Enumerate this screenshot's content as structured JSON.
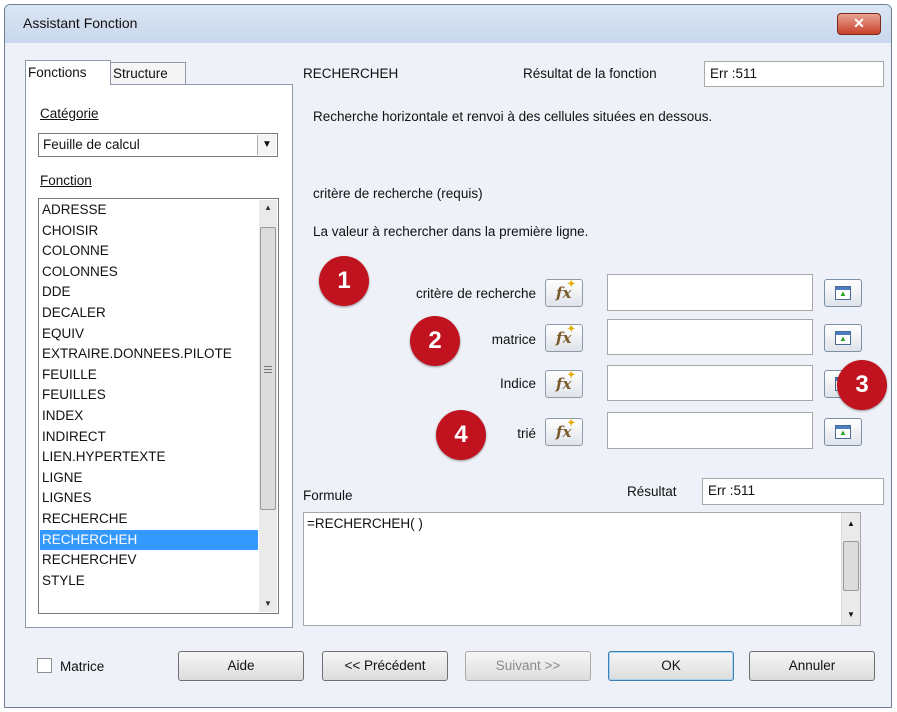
{
  "window": {
    "title": "Assistant Fonction",
    "close_label": "✕"
  },
  "tabs": [
    {
      "label": "Fonctions"
    },
    {
      "label": "Structure"
    }
  ],
  "left": {
    "category_label": "Catégorie",
    "category_value": "Feuille de calcul",
    "function_label": "Fonction",
    "functions": [
      "ADRESSE",
      "CHOISIR",
      "COLONNE",
      "COLONNES",
      "DDE",
      "DECALER",
      "EQUIV",
      "EXTRAIRE.DONNEES.PILOTE",
      "FEUILLE",
      "FEUILLES",
      "INDEX",
      "INDIRECT",
      "LIEN.HYPERTEXTE",
      "LIGNE",
      "LIGNES",
      "RECHERCHE",
      "RECHERCHEH",
      "RECHERCHEV",
      "STYLE"
    ],
    "selected_function": "RECHERCHEH"
  },
  "right": {
    "function_name": "RECHERCHEH",
    "result_fn_label": "Résultat de la fonction",
    "result_fn_value": "Err :511",
    "description": "Recherche horizontale et renvoi à des cellules situées en dessous.",
    "arg_title": "critère de recherche (requis)",
    "arg_desc": "La valeur à rechercher dans la première ligne.",
    "args": [
      {
        "label": "critère de recherche",
        "value": ""
      },
      {
        "label": "matrice",
        "value": ""
      },
      {
        "label": "Indice",
        "value": ""
      },
      {
        "label": "trié",
        "value": ""
      }
    ],
    "formula_label": "Formule",
    "result_label": "Résultat",
    "result_value": "Err :511",
    "formula_text": "=RECHERCHEH( )"
  },
  "badges": [
    "1",
    "2",
    "3",
    "4"
  ],
  "fx_icon_text": "fx",
  "buttons": {
    "matrix_label": "Matrice",
    "help": "Aide",
    "previous": "<< Précédent",
    "next": "Suivant >>",
    "ok": "OK",
    "cancel": "Annuler"
  },
  "colors": {
    "selection": "#3399ff",
    "badge": "#c1121f",
    "close_button": "#c7412a"
  }
}
